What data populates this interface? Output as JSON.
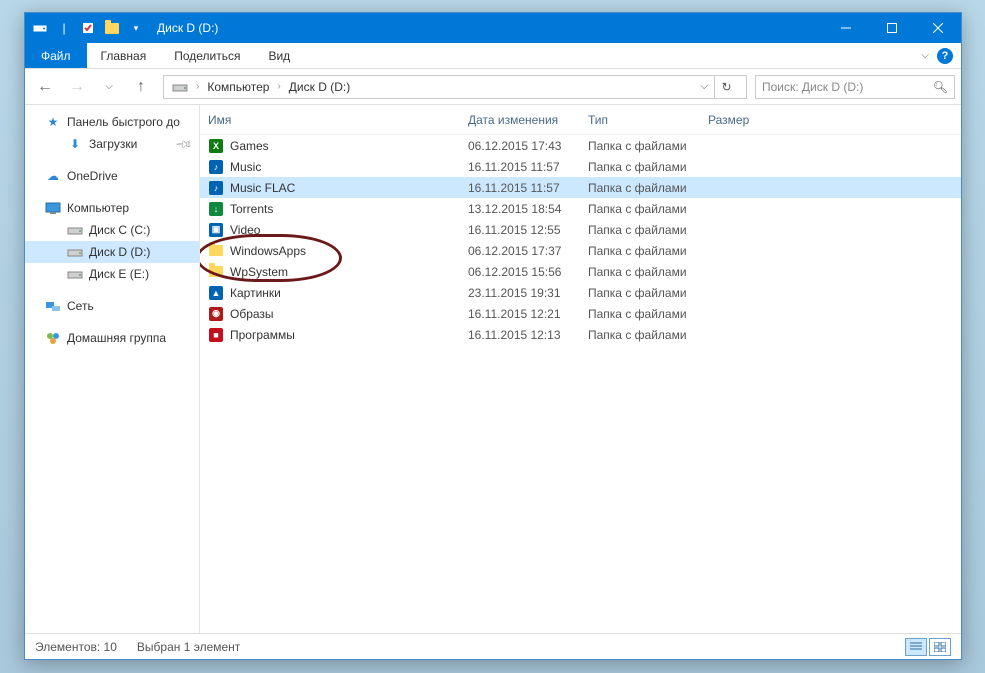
{
  "window": {
    "title": "Диск D (D:)"
  },
  "ribbon": {
    "file": "Файл",
    "tabs": [
      "Главная",
      "Поделиться",
      "Вид"
    ]
  },
  "breadcrumb": {
    "segments": [
      "Компьютер",
      "Диск D (D:)"
    ]
  },
  "search": {
    "placeholder": "Поиск: Диск D (D:)"
  },
  "sidebar": {
    "quick_access": "Панель быстрого до",
    "downloads": "Загрузки",
    "onedrive": "OneDrive",
    "computer": "Компьютер",
    "drives": [
      {
        "label": "Диск C (C:)",
        "selected": false
      },
      {
        "label": "Диск D (D:)",
        "selected": true
      },
      {
        "label": "Диск E (E:)",
        "selected": false
      }
    ],
    "network": "Сеть",
    "homegroup": "Домашняя группа"
  },
  "columns": {
    "name": "Имя",
    "date": "Дата изменения",
    "type": "Тип",
    "size": "Размер"
  },
  "files": [
    {
      "icon": "xbox",
      "name": "Games",
      "date": "06.12.2015 17:43",
      "type": "Папка с файлами",
      "selected": false
    },
    {
      "icon": "music",
      "name": "Music",
      "date": "16.11.2015 11:57",
      "type": "Папка с файлами",
      "selected": false
    },
    {
      "icon": "music",
      "name": "Music FLAC",
      "date": "16.11.2015 11:57",
      "type": "Папка с файлами",
      "selected": true
    },
    {
      "icon": "torrent",
      "name": "Torrents",
      "date": "13.12.2015 18:54",
      "type": "Папка с файлами",
      "selected": false
    },
    {
      "icon": "video",
      "name": "Video",
      "date": "16.11.2015 12:55",
      "type": "Папка с файлами",
      "selected": false
    },
    {
      "icon": "folder",
      "name": "WindowsApps",
      "date": "06.12.2015 17:37",
      "type": "Папка с файлами",
      "selected": false
    },
    {
      "icon": "folder",
      "name": "WpSystem",
      "date": "06.12.2015 15:56",
      "type": "Папка с файлами",
      "selected": false
    },
    {
      "icon": "picture",
      "name": "Картинки",
      "date": "23.11.2015 19:31",
      "type": "Папка с файлами",
      "selected": false
    },
    {
      "icon": "disc",
      "name": "Образы",
      "date": "16.11.2015 12:21",
      "type": "Папка с файлами",
      "selected": false
    },
    {
      "icon": "apps",
      "name": "Программы",
      "date": "16.11.2015 12:13",
      "type": "Папка с файлами",
      "selected": false
    }
  ],
  "status": {
    "count": "Элементов: 10",
    "selection": "Выбран 1 элемент"
  },
  "icon_colors": {
    "xbox": "#107c10",
    "music": "#0063b1",
    "torrent": "#10893e",
    "video": "#0063b1",
    "picture": "#0063b1",
    "disc": "#b01a1a",
    "apps": "#c50f1f"
  }
}
